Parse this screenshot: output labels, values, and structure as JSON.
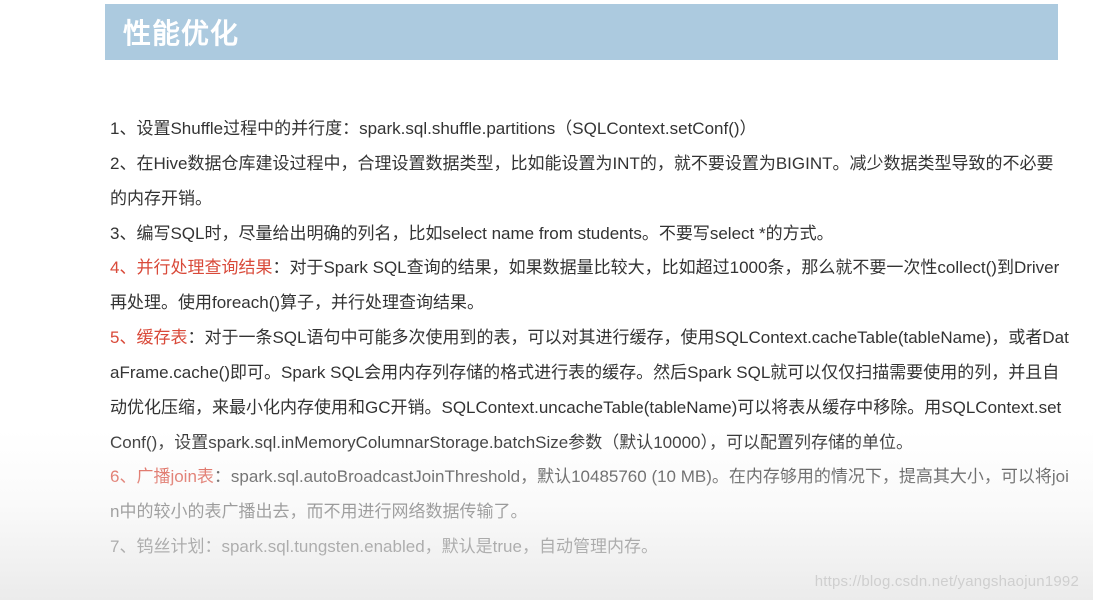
{
  "header": {
    "title": "性能优化"
  },
  "items": {
    "p1": "1、设置Shuffle过程中的并行度：spark.sql.shuffle.partitions（SQLContext.setConf()）",
    "p2": "2、在Hive数据仓库建设过程中，合理设置数据类型，比如能设置为INT的，就不要设置为BIGINT。减少数据类型导致的不必要的内存开销。",
    "p3": "3、编写SQL时，尽量给出明确的列名，比如select name from students。不要写select *的方式。",
    "p4_h": "4、并行处理查询结果",
    "p4_t": "：对于Spark SQL查询的结果，如果数据量比较大，比如超过1000条，那么就不要一次性collect()到Driver再处理。使用foreach()算子，并行处理查询结果。",
    "p5_h": "5、缓存表",
    "p5_t": "：对于一条SQL语句中可能多次使用到的表，可以对其进行缓存，使用SQLContext.cacheTable(tableName)，或者DataFrame.cache()即可。Spark SQL会用内存列存储的格式进行表的缓存。然后Spark SQL就可以仅仅扫描需要使用的列，并且自动优化压缩，来最小化内存使用和GC开销。SQLContext.uncacheTable(tableName)可以将表从缓存中移除。用SQLContext.setConf()，设置spark.sql.inMemoryColumnarStorage.batchSize参数（默认10000），可以配置列存储的单位。",
    "p6_h": "6、广播join表",
    "p6_t": "：spark.sql.autoBroadcastJoinThreshold，默认10485760 (10 MB)。在内存够用的情况下，提高其大小，可以将join中的较小的表广播出去，而不用进行网络数据传输了。",
    "p7": "7、钨丝计划：spark.sql.tungsten.enabled，默认是true，自动管理内存。"
  },
  "watermark": "https://blog.csdn.net/yangshaojun1992"
}
